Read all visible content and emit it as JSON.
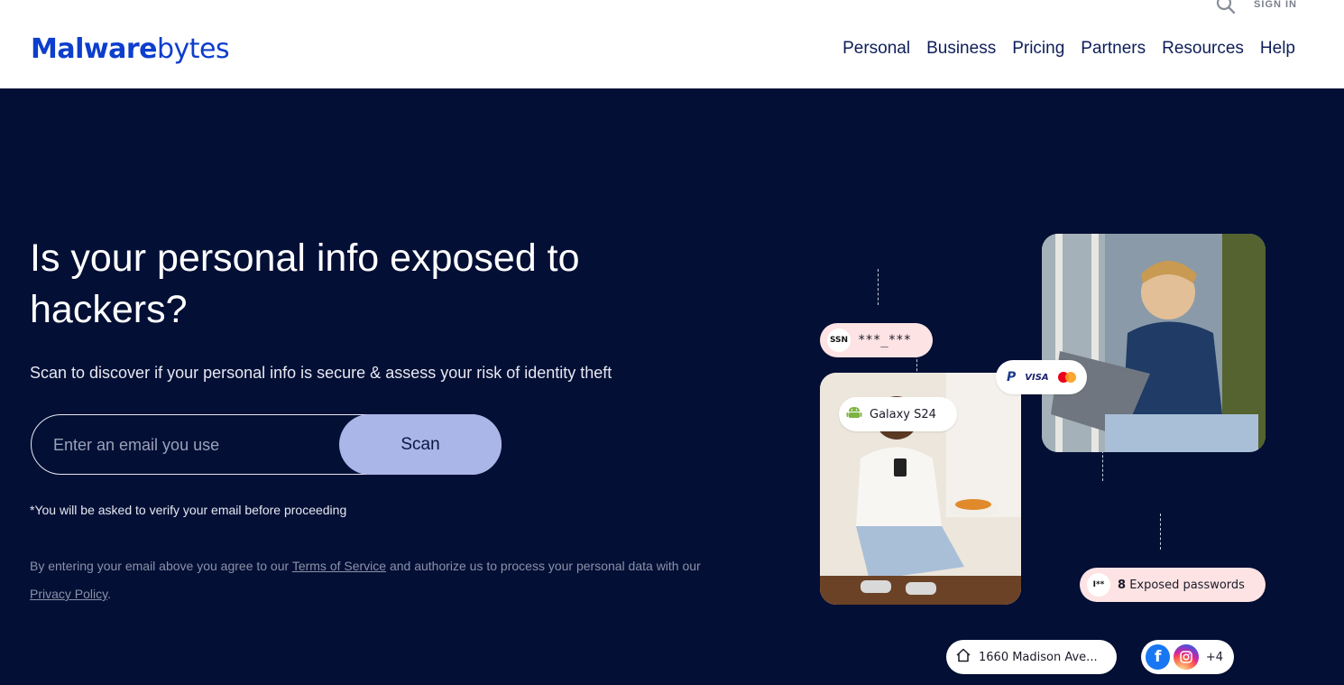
{
  "header": {
    "logo_text_bold": "Malware",
    "logo_text_light": "bytes",
    "sign_in": "SIGN IN",
    "nav": [
      "Personal",
      "Business",
      "Pricing",
      "Partners",
      "Resources",
      "Help"
    ]
  },
  "hero": {
    "headline": "Is your personal info exposed to hackers?",
    "subhead": "Scan to discover if your personal info is secure & assess your risk of identity theft",
    "email_placeholder": "Enter an email you use",
    "scan_label": "Scan",
    "verify_note": "*You will be asked to verify your email before proceeding",
    "legal_prefix": "By entering your email above you agree to our ",
    "terms_link": "Terms of Service",
    "legal_middle": " and authorize us to process your personal data with our ",
    "privacy_link": "Privacy Policy",
    "legal_suffix": "."
  },
  "illustration": {
    "ssn_badge": "SSN",
    "ssn_value": "***_***",
    "device": "Galaxy S24",
    "payment_logos": [
      "PayPal",
      "VISA",
      "Mastercard"
    ],
    "password_icon": "I**",
    "password_count": "8",
    "password_label": "Exposed passwords",
    "address": "1660 Madison Ave...",
    "social_more": "+4"
  },
  "colors": {
    "brand": "#0d3ecc",
    "hero_bg": "#030f35",
    "scan_button": "#aab5e8",
    "pink_pill": "#fde3e3"
  }
}
